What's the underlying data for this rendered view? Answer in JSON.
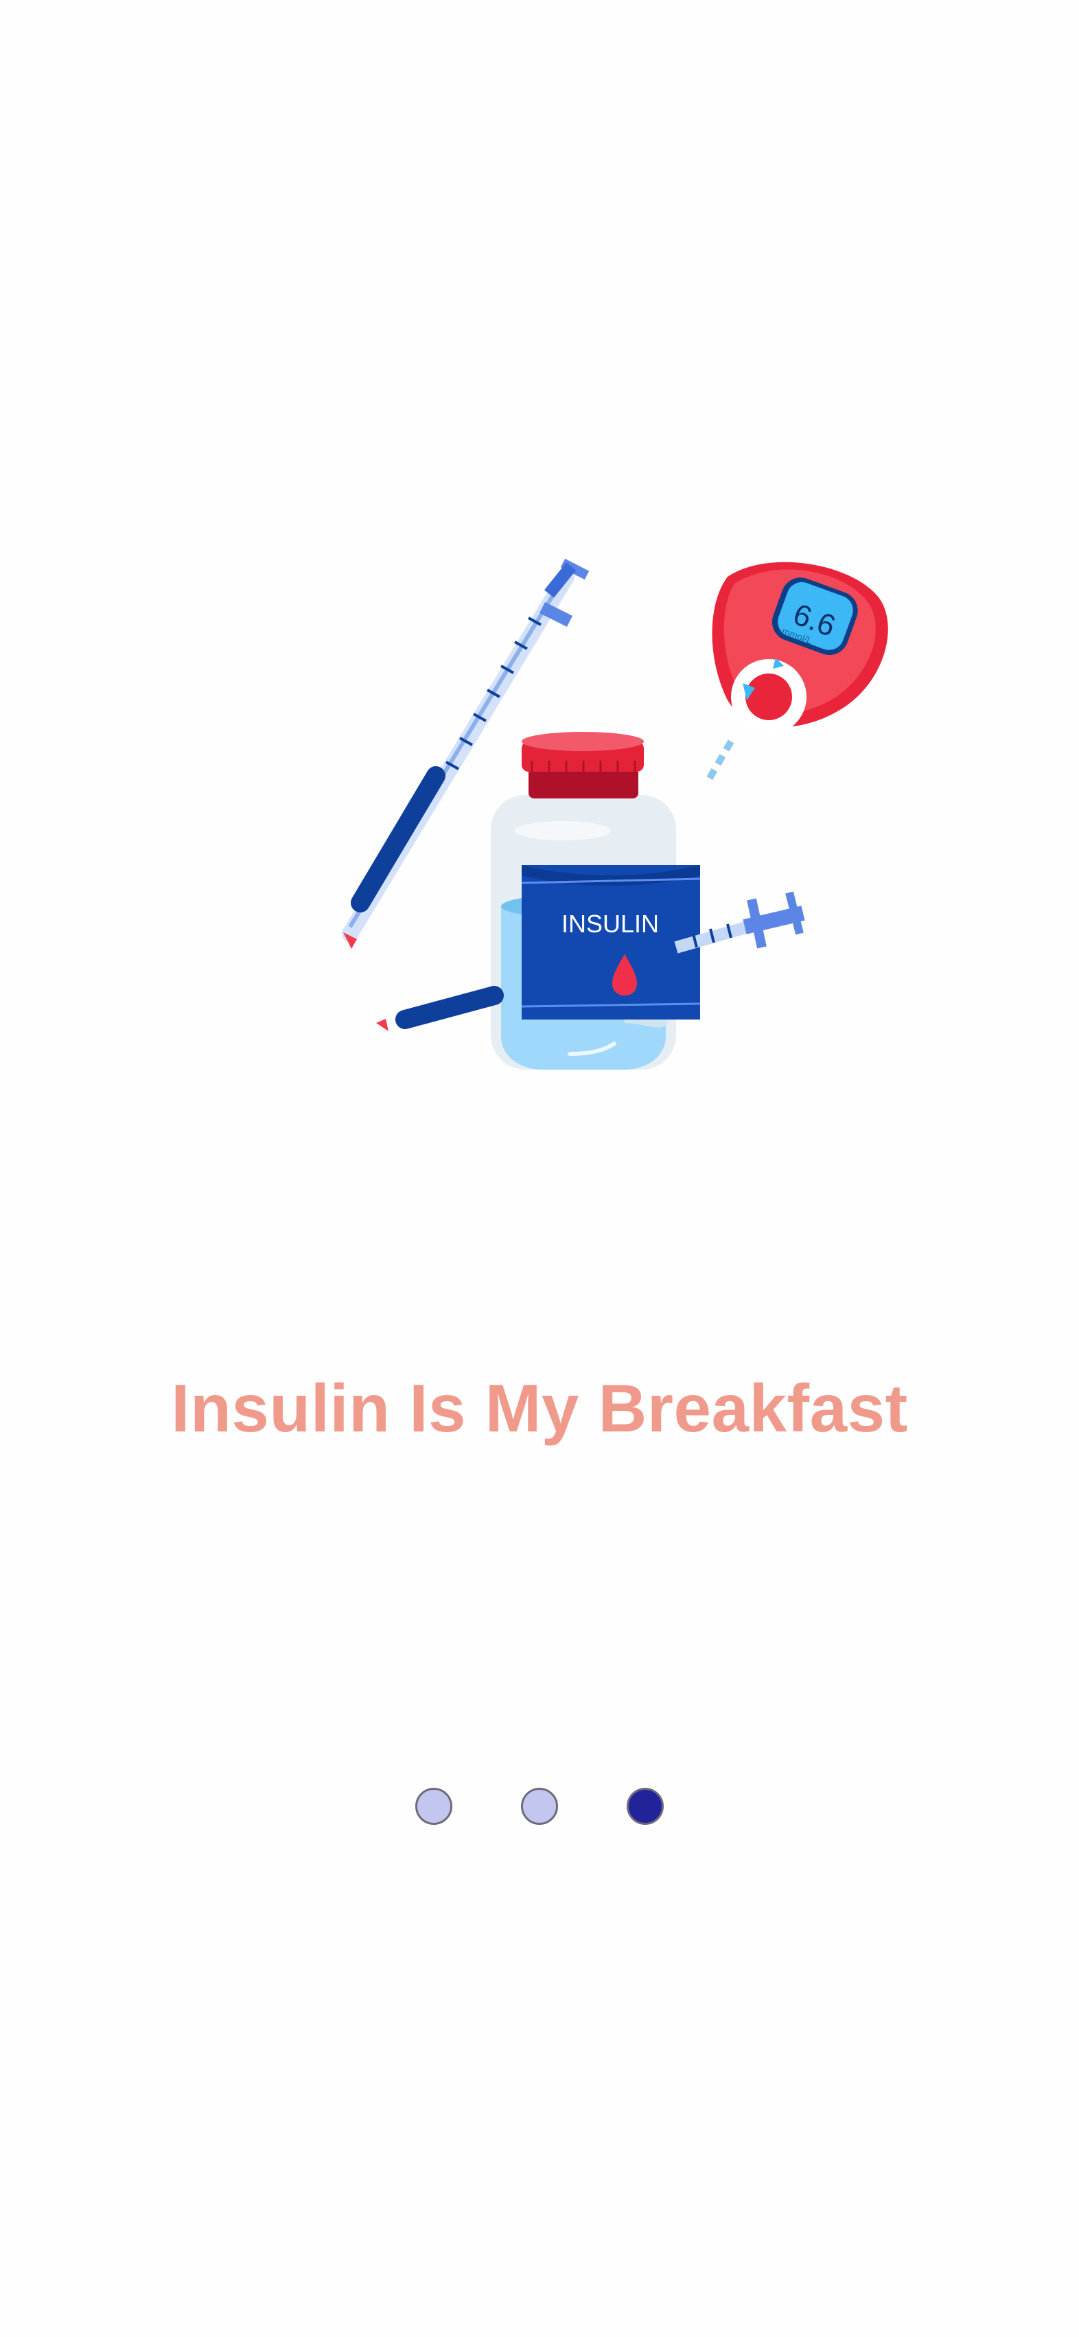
{
  "illustration": {
    "vial_label": "INSULIN",
    "meter_reading": "6.6",
    "meter_unit": "mmol/L"
  },
  "onboarding": {
    "title": "Insulin Is My Breakfast",
    "page_count": 3,
    "active_page": 3
  },
  "colors": {
    "title": "#f09a8c",
    "dot_inactive": "#c3c7ef",
    "dot_active": "#22229a"
  }
}
